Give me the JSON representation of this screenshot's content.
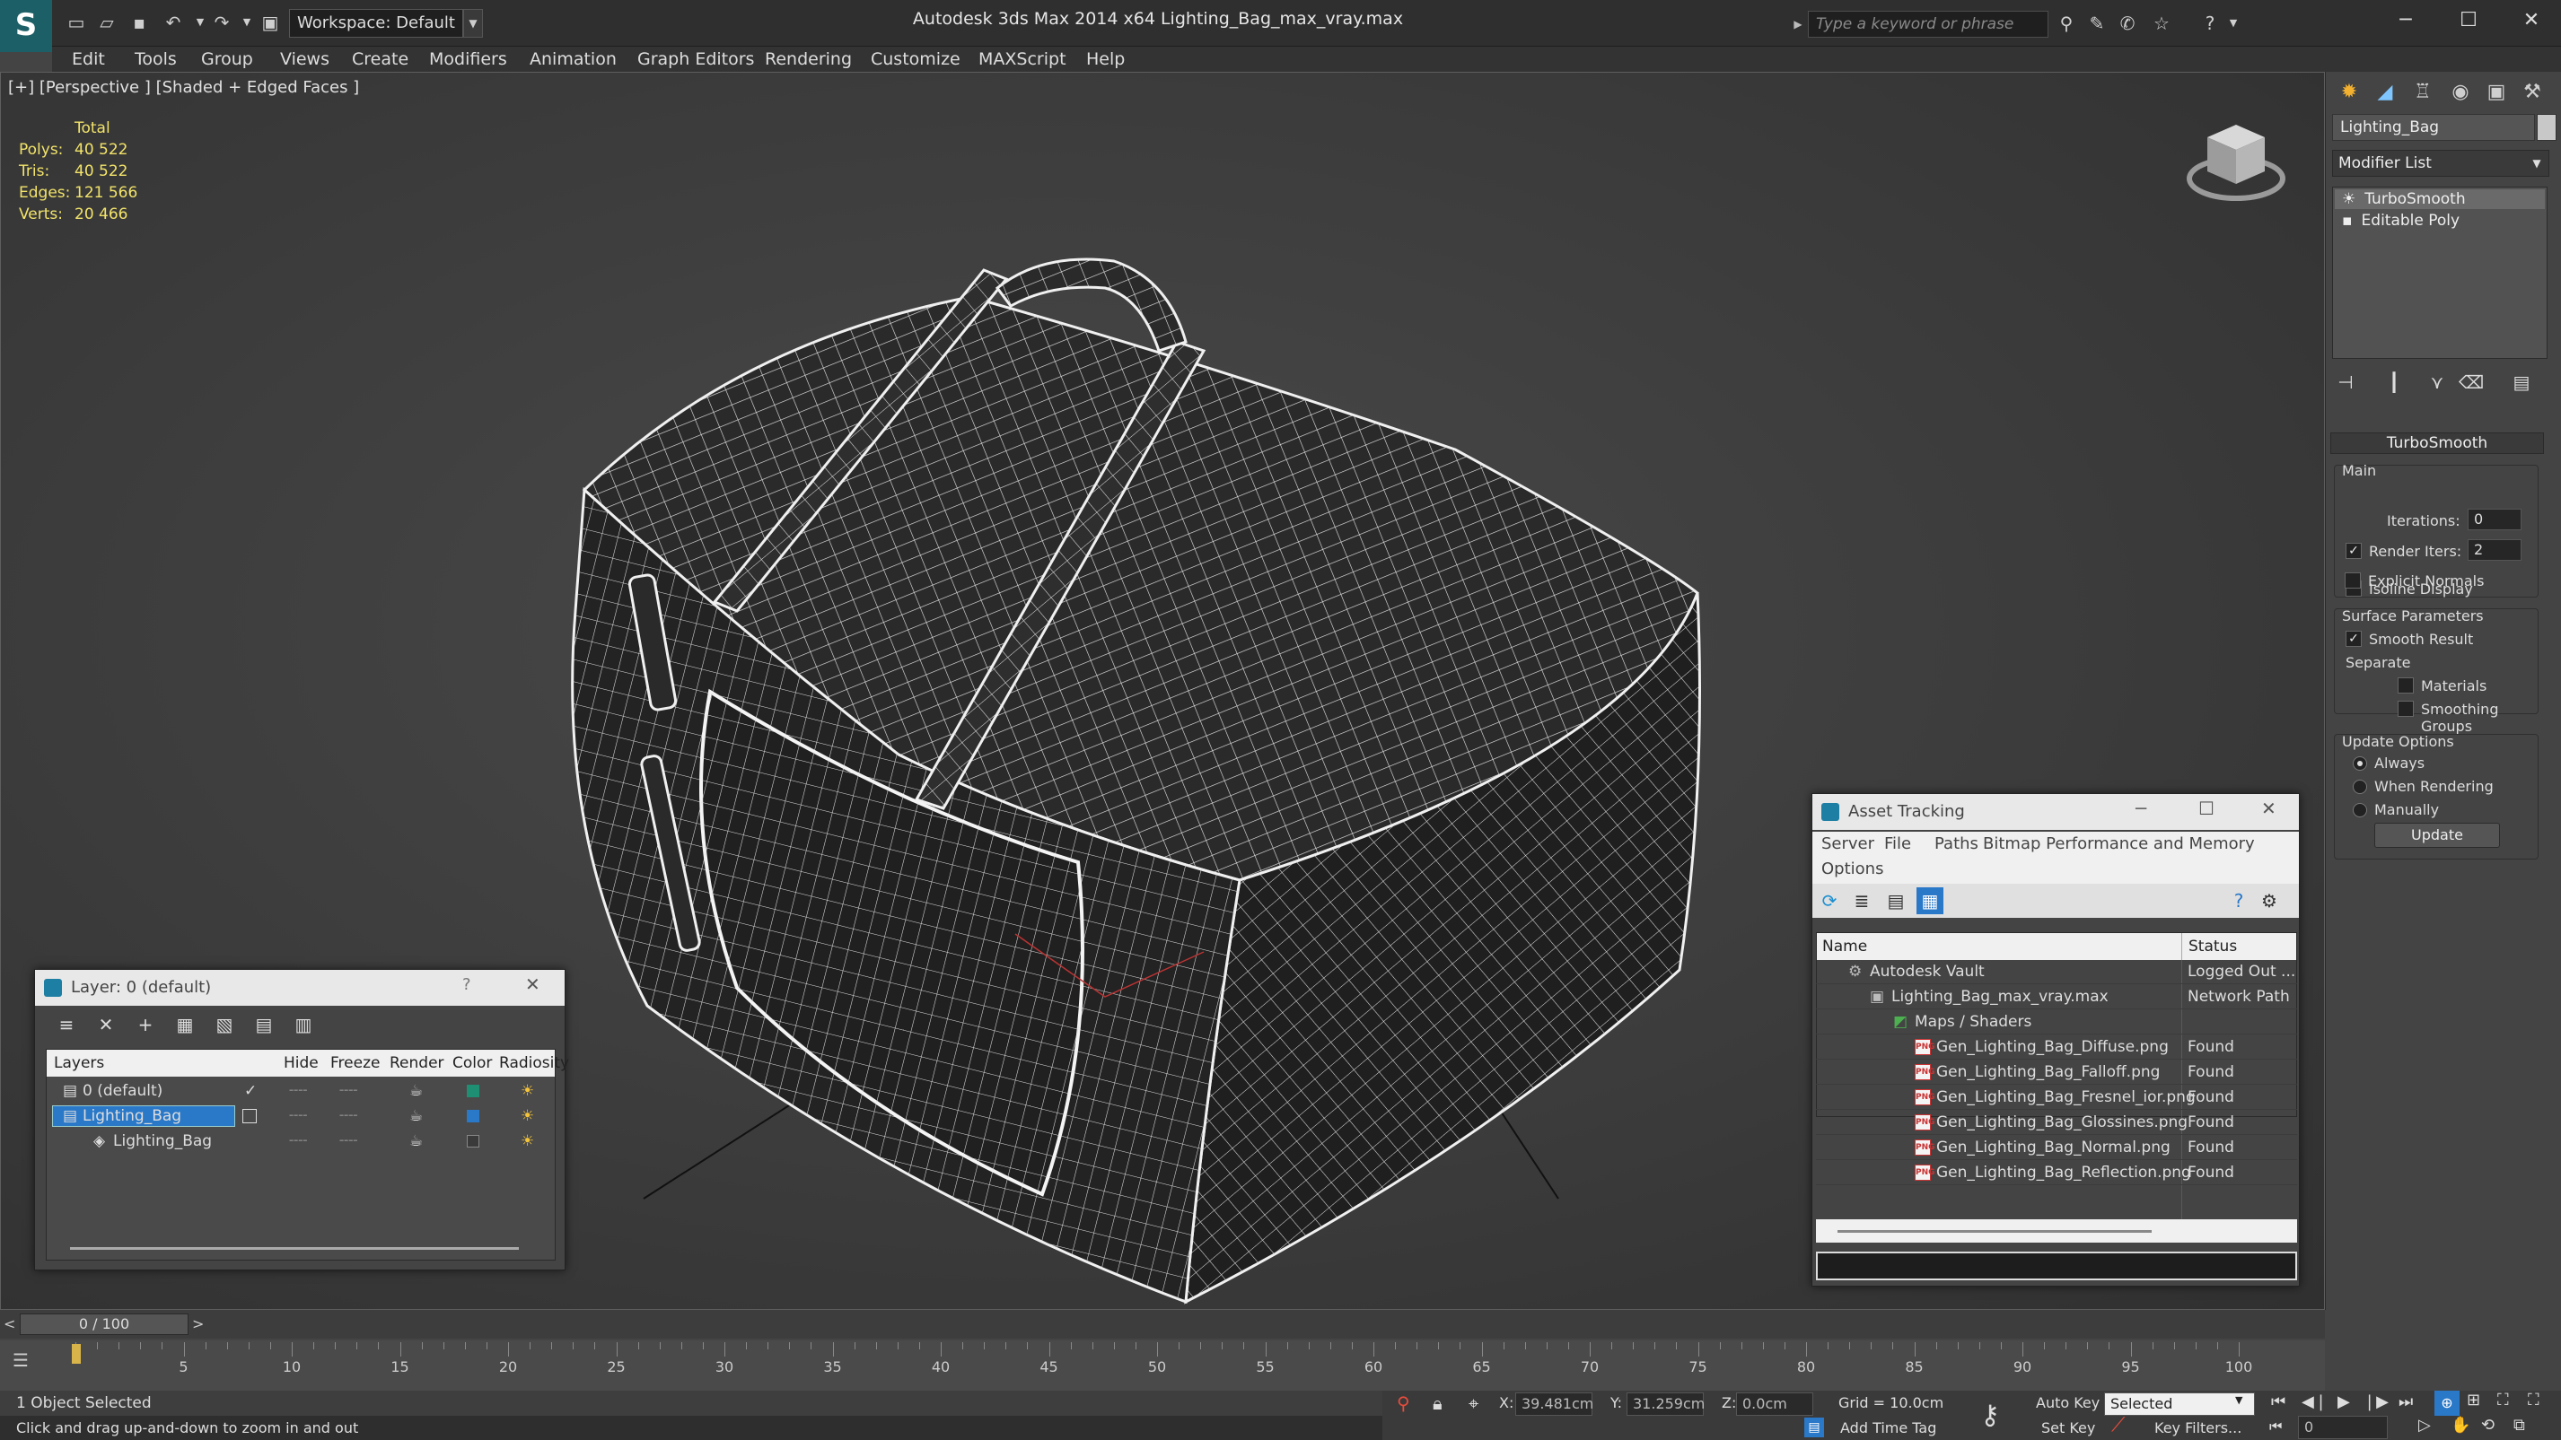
{
  "titlebar": {
    "app_title": "Autodesk 3ds Max  2014 x64     Lighting_Bag_max_vray.max",
    "workspace_label": "Workspace: Default",
    "search_placeholder": "Type a keyword or phrase",
    "logo": "S"
  },
  "menu": [
    "Edit",
    "Tools",
    "Group",
    "Views",
    "Create",
    "Modifiers",
    "Animation",
    "Graph Editors",
    "Rendering",
    "Customize",
    "MAXScript",
    "Help"
  ],
  "viewport": {
    "label": "[+] [Perspective ] [Shaded + Edged Faces ]",
    "stats_header": "Total",
    "stats": [
      {
        "k": "Polys:",
        "v": "40 522"
      },
      {
        "k": "Tris:",
        "v": "40 522"
      },
      {
        "k": "Edges:",
        "v": "121 566"
      },
      {
        "k": "Verts:",
        "v": "20 466"
      }
    ]
  },
  "command_panel": {
    "object_name": "Lighting_Bag",
    "modifier_list": "Modifier List",
    "stack": [
      "TurboSmooth",
      "Editable Poly"
    ],
    "rollout_title": "TurboSmooth",
    "main_group": "Main",
    "iterations_label": "Iterations:",
    "iterations_value": "0",
    "render_iters_label": "Render Iters:",
    "render_iters_value": "2",
    "isoline_label": "Isoline Display",
    "explicit_normals_label": "Explicit Normals",
    "surface_group": "Surface Parameters",
    "smooth_result_label": "Smooth Result",
    "separate_label": "Separate",
    "materials_label": "Materials",
    "smoothing_groups_label": "Smoothing Groups",
    "update_group": "Update Options",
    "always_label": "Always",
    "when_rendering_label": "When Rendering",
    "manually_label": "Manually",
    "update_button": "Update"
  },
  "layer_window": {
    "title": "Layer: 0 (default)",
    "help": "?",
    "columns": [
      "Layers",
      "Hide",
      "Freeze",
      "Render",
      "Color",
      "Radiosity"
    ],
    "rows": [
      {
        "name": "0 (default)",
        "color": "#1e8f72"
      },
      {
        "name": "Lighting_Bag",
        "color": "#2a78c8"
      },
      {
        "name": "Lighting_Bag",
        "color": "#3a3a3a"
      }
    ]
  },
  "asset_tracking": {
    "title": "Asset Tracking",
    "menu": [
      "Server",
      "File",
      "Paths",
      "Bitmap Performance and Memory"
    ],
    "menu2": "Options",
    "columns": [
      "Name",
      "Status"
    ],
    "rows": [
      {
        "name": "Autodesk Vault",
        "status": "Logged Out ..."
      },
      {
        "name": "Lighting_Bag_max_vray.max",
        "status": "Network Path"
      },
      {
        "name": "Maps / Shaders",
        "status": ""
      },
      {
        "name": "Gen_Lighting_Bag_Diffuse.png",
        "status": "Found"
      },
      {
        "name": "Gen_Lighting_Bag_Falloff.png",
        "status": "Found"
      },
      {
        "name": "Gen_Lighting_Bag_Fresnel_ior.png",
        "status": "Found"
      },
      {
        "name": "Gen_Lighting_Bag_Glossines.png",
        "status": "Found"
      },
      {
        "name": "Gen_Lighting_Bag_Normal.png",
        "status": "Found"
      },
      {
        "name": "Gen_Lighting_Bag_Reflection.png",
        "status": "Found"
      }
    ]
  },
  "timeline": {
    "frame_counter": "0 / 100",
    "ticks": [
      "5",
      "10",
      "15",
      "20",
      "25",
      "30",
      "35",
      "40",
      "45",
      "50",
      "55",
      "60",
      "65",
      "70",
      "75",
      "80",
      "85",
      "90",
      "95",
      "100"
    ]
  },
  "status": {
    "selection": "1 Object Selected",
    "prompt": "Click and drag up-and-down to zoom in and out",
    "x_label": "X:",
    "x_value": "39.481cm",
    "y_label": "Y:",
    "y_value": "31.259cm",
    "z_label": "Z:",
    "z_value": "0.0cm",
    "grid": "Grid = 10.0cm",
    "add_time_tag": "Add Time Tag",
    "auto_key": "Auto Key",
    "set_key": "Set Key",
    "selected_dropdown": "Selected",
    "key_filters": "Key Filters...",
    "frame_field": "0"
  },
  "colors": {
    "accent": "#1d7fa3",
    "stats_yellow": "#f2e36a",
    "selection_blue": "#2a78c8"
  }
}
